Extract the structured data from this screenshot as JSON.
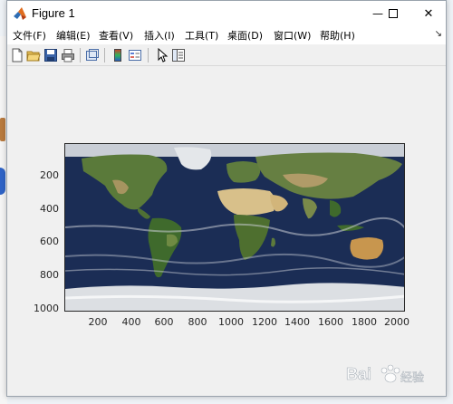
{
  "window": {
    "title": "Figure 1",
    "minimize_glyph": "—",
    "maximize_glyph": "☐",
    "close_glyph": "✕"
  },
  "menu": {
    "items": [
      {
        "label": "文件(F)"
      },
      {
        "label": "编辑(E)"
      },
      {
        "label": "查看(V)"
      },
      {
        "label": "插入(I)"
      },
      {
        "label": "工具(T)"
      },
      {
        "label": "桌面(D)"
      },
      {
        "label": "窗口(W)"
      },
      {
        "label": "帮助(H)"
      }
    ],
    "dock_glyph": "↘"
  },
  "toolbar": {
    "icons": [
      "new-figure-icon",
      "open-file-icon",
      "save-icon",
      "print-icon",
      "link-plot-icon",
      "colorbar-icon",
      "legend-icon",
      "select-pointer-icon",
      "property-editor-icon"
    ]
  },
  "axes": {
    "yticks": [
      "200",
      "400",
      "600",
      "800",
      "1000"
    ],
    "xticks": [
      "200",
      "400",
      "600",
      "800",
      "1000",
      "1200",
      "1400",
      "1600",
      "1800",
      "2000"
    ]
  },
  "colors": {
    "ocean": "#1b2d55",
    "land": "#5a7a3a",
    "desert": "#d8c08a",
    "ice": "#dcdfe3",
    "axis": "#262626",
    "window_bg": "#f0f0f0"
  },
  "watermark": {
    "text": "Bai 经验"
  }
}
